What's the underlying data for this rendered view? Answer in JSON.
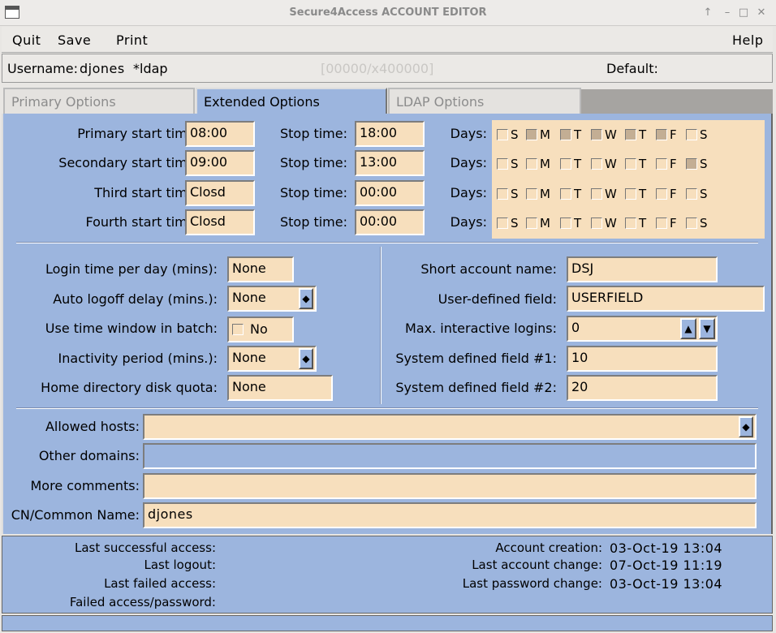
{
  "window": {
    "title": "Secure4Access ACCOUNT EDITOR",
    "btn_up": "↑",
    "btn_min": "–",
    "btn_max": "□",
    "btn_close": "✕"
  },
  "menu": {
    "quit": "Quit",
    "save": "Save",
    "print": "Print",
    "help": "Help"
  },
  "user": {
    "label": "Username:",
    "name": "djones",
    "tag": "*ldap",
    "range": "[00000/x400000]",
    "default_label": "Default:"
  },
  "tabs": [
    "Primary Options",
    "Extended Options",
    "LDAP Options"
  ],
  "schedule": [
    {
      "label": "Primary start time:",
      "start": "08:00",
      "stop_label": "Stop time:",
      "stop": "18:00",
      "days_label": "Days:",
      "days": [
        false,
        true,
        true,
        true,
        true,
        true,
        false
      ]
    },
    {
      "label": "Secondary start time:",
      "start": "09:00",
      "stop_label": "Stop time:",
      "stop": "13:00",
      "days_label": "Days:",
      "days": [
        false,
        false,
        false,
        false,
        false,
        false,
        true
      ]
    },
    {
      "label": "Third start time:",
      "start": "Closd",
      "stop_label": "Stop time:",
      "stop": "00:00",
      "days_label": "Days:",
      "days": [
        false,
        false,
        false,
        false,
        false,
        false,
        false
      ]
    },
    {
      "label": "Fourth start time:",
      "start": "Closd",
      "stop_label": "Stop time:",
      "stop": "00:00",
      "days_label": "Days:",
      "days": [
        false,
        false,
        false,
        false,
        false,
        false,
        false
      ]
    }
  ],
  "day_letters": [
    "S",
    "M",
    "T",
    "W",
    "T",
    "F",
    "S"
  ],
  "left_opts": {
    "login_time_label": "Login time per day (mins):",
    "login_time": "None",
    "auto_logoff_label": "Auto logoff delay (mins.):",
    "auto_logoff": "None",
    "time_window_label": "Use time window in batch:",
    "time_window": "No",
    "inactivity_label": "Inactivity period (mins.):",
    "inactivity": "None",
    "quota_label": "Home directory disk quota:",
    "quota": "None"
  },
  "right_opts": {
    "short_name_label": "Short account name:",
    "short_name": "DSJ",
    "user_field_label": "User-defined field:",
    "user_field": "USERFIELD",
    "max_logins_label": "Max. interactive logins:",
    "max_logins": "0",
    "sys1_label": "System defined field #1:",
    "sys1": "10",
    "sys2_label": "System defined field #2:",
    "sys2": "20"
  },
  "bottom": {
    "allowed_hosts_label": "Allowed hosts:",
    "allowed_hosts": "",
    "other_domains_label": "Other domains:",
    "other_domains": "",
    "comments_label": "More comments:",
    "comments": "",
    "cn_label": "CN/Common Name:",
    "cn": "djones"
  },
  "footer": {
    "last_success_label": "Last successful access:",
    "last_logout_label": "Last logout:",
    "last_failed_label": "Last failed access:",
    "failed_pw_label": "Failed access/password:",
    "creation_label": "Account creation:",
    "creation": "03-Oct-19 13:04",
    "change_label": "Last account change:",
    "change": "07-Oct-19 11:19",
    "pw_change_label": "Last password change:",
    "pw_change": "03-Oct-19 13:04"
  }
}
